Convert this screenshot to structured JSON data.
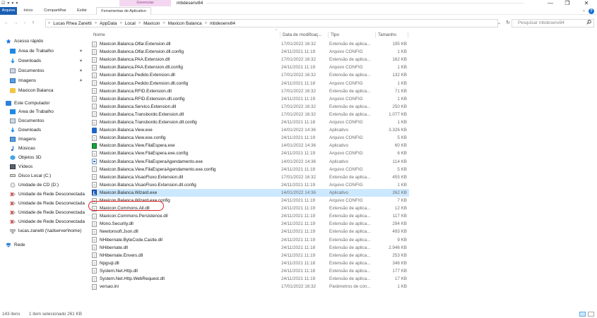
{
  "window": {
    "title": "mbdesenv84",
    "context_tab_group": "Gerenciar",
    "controls": {
      "minimize": "—",
      "maximize": "❐",
      "close": "✕"
    }
  },
  "quick_access_toolbar": {
    "items": [
      "☑",
      "▾",
      "▾",
      "▾"
    ]
  },
  "ribbon": {
    "tabs": [
      "Arquivo",
      "Início",
      "Compartilhar",
      "Exibir",
      "Ferramentas de Aplicativo"
    ],
    "help": "?",
    "collapse": "⌄"
  },
  "address_bar": {
    "nav": {
      "back": "←",
      "forward": "→",
      "recent": "⌄",
      "up": "↑"
    },
    "crumbs": [
      "Lucas Rhea Zanetti",
      "AppData",
      "Local",
      "Maxicon",
      "Maxicon Balanca",
      "mbdesenv84"
    ],
    "separator": ">",
    "dropdown": "⌄",
    "refresh": "↻",
    "search_placeholder": "Pesquisar mbdesenv84"
  },
  "nav_pane": {
    "quick_access_label": "Acesso rápido",
    "quick_access_items": [
      {
        "label": "Área de Trabalho",
        "icon": "desktop-icon",
        "pinned": true
      },
      {
        "label": "Downloads",
        "icon": "downloads-icon",
        "pinned": true
      },
      {
        "label": "Documentos",
        "icon": "documents-icon",
        "pinned": true
      },
      {
        "label": "Imagens",
        "icon": "pictures-icon",
        "pinned": true
      },
      {
        "label": "Maxicon Balanca",
        "icon": "folder-icon",
        "pinned": false
      }
    ],
    "this_pc_label": "Este Computador",
    "this_pc_items": [
      {
        "label": "Área de Trabalho",
        "icon": "desktop-icon"
      },
      {
        "label": "Documentos",
        "icon": "documents-icon"
      },
      {
        "label": "Downloads",
        "icon": "downloads-icon"
      },
      {
        "label": "Imagens",
        "icon": "pictures-icon"
      },
      {
        "label": "Músicas",
        "icon": "music-icon"
      },
      {
        "label": "Objetos 3D",
        "icon": "objects3d-icon"
      },
      {
        "label": "Vídeos",
        "icon": "videos-icon"
      },
      {
        "label": "Disco Local (C:)",
        "icon": "drive-icon"
      },
      {
        "label": "Unidade de CD (D:)",
        "icon": "cd-drive-icon"
      },
      {
        "label": "Unidade de Rede Desconectada",
        "icon": "network-drive-disconnected-icon"
      },
      {
        "label": "Unidade de Rede Desconectada",
        "icon": "network-drive-disconnected-icon"
      },
      {
        "label": "Unidade de Rede Desconectada",
        "icon": "network-drive-disconnected-icon"
      },
      {
        "label": "Unidade de Rede Desconectada",
        "icon": "network-drive-disconnected-icon"
      },
      {
        "label": "lucas.zanetti (\\\\adserver\\home)",
        "icon": "network-drive-icon"
      }
    ],
    "network_label": "Rede",
    "pin_glyph": "✶"
  },
  "file_list": {
    "columns": {
      "name": "Nome",
      "date": "Data de modificaç...",
      "type": "Tipo",
      "size": "Tamanho"
    },
    "sort_glyph": "^",
    "selected_index": 21,
    "rows": [
      {
        "name": "Maxicon.Balanca.Olfar.Extension.dll",
        "date": "17/01/2022 16:32",
        "type": "Extensão de aplica...",
        "size": "195 KB",
        "icon": "doc"
      },
      {
        "name": "Maxicon.Balanca.Olfar.Extension.dll.config",
        "date": "24/11/2021 11:19",
        "type": "Arquivo CONFIG",
        "size": "1 KB",
        "icon": "doc"
      },
      {
        "name": "Maxicon.Balanca.PAA.Extension.dll",
        "date": "17/01/2022 16:32",
        "type": "Extensão de aplica...",
        "size": "162 KB",
        "icon": "doc"
      },
      {
        "name": "Maxicon.Balanca.PAA.Extension.dll.config",
        "date": "24/11/2021 11:19",
        "type": "Arquivo CONFIG",
        "size": "1 KB",
        "icon": "doc"
      },
      {
        "name": "Maxicon.Balanca.Pedido.Extension.dll",
        "date": "17/01/2022 16:32",
        "type": "Extensão de aplica...",
        "size": "132 KB",
        "icon": "doc"
      },
      {
        "name": "Maxicon.Balanca.Pedido.Extension.dll.config",
        "date": "24/11/2021 11:18",
        "type": "Arquivo CONFIG",
        "size": "1 KB",
        "icon": "doc"
      },
      {
        "name": "Maxicon.Balanca.RFID.Extension.dll",
        "date": "17/01/2022 16:32",
        "type": "Extensão de aplica...",
        "size": "71 KB",
        "icon": "doc"
      },
      {
        "name": "Maxicon.Balanca.RFID.Extension.dll.config",
        "date": "24/11/2021 11:19",
        "type": "Arquivo CONFIG",
        "size": "1 KB",
        "icon": "doc"
      },
      {
        "name": "Maxicon.Balanca.Servico.Extension.dll",
        "date": "17/01/2022 16:32",
        "type": "Extensão de aplica...",
        "size": "250 KB",
        "icon": "doc"
      },
      {
        "name": "Maxicon.Balanca.Transbordo.Extension.dll",
        "date": "17/01/2022 16:32",
        "type": "Extensão de aplica...",
        "size": "1.077 KB",
        "icon": "doc"
      },
      {
        "name": "Maxicon.Balanca.Transbordo.Extension.dll.config",
        "date": "24/11/2021 11:18",
        "type": "Arquivo CONFIG",
        "size": "1 KB",
        "icon": "doc"
      },
      {
        "name": "Maxicon.Balanca.View.exe",
        "date": "14/01/2022 14:36",
        "type": "Aplicativo",
        "size": "3.326 KB",
        "icon": "exe-blue"
      },
      {
        "name": "Maxicon.Balanca.View.exe.config",
        "date": "24/11/2021 11:19",
        "type": "Arquivo CONFIG",
        "size": "5 KB",
        "icon": "doc"
      },
      {
        "name": "Maxicon.Balanca.View.FilaEspera.exe",
        "date": "14/01/2022 14:36",
        "type": "Aplicativo",
        "size": "60 KB",
        "icon": "exe-green"
      },
      {
        "name": "Maxicon.Balanca.View.FilaEspera.exe.config",
        "date": "24/11/2021 11:19",
        "type": "Arquivo CONFIG",
        "size": "6 KB",
        "icon": "doc"
      },
      {
        "name": "Maxicon.Balanca.View.FilaEsperaAgendamento.exe",
        "date": "14/01/2022 14:36",
        "type": "Aplicativo",
        "size": "114 KB",
        "icon": "exe-app"
      },
      {
        "name": "Maxicon.Balanca.View.FilaEsperaAgendamento.exe.config",
        "date": "24/11/2021 11:18",
        "type": "Arquivo CONFIG",
        "size": "5 KB",
        "icon": "doc"
      },
      {
        "name": "Maxicon.Balanca.VisaoFluxo.Extension.dll",
        "date": "17/01/2022 16:32",
        "type": "Extensão de aplica...",
        "size": "455 KB",
        "icon": "doc"
      },
      {
        "name": "Maxicon.Balanca.VisaoFluxo.Extension.dll.config",
        "date": "24/11/2021 11:19",
        "type": "Arquivo CONFIG",
        "size": "1 KB",
        "icon": "doc"
      },
      {
        "name": "Maxicon.Balanca.Wizard.exe",
        "date": "14/01/2022 14:36",
        "type": "Aplicativo",
        "size": "262 KB",
        "icon": "wizard"
      },
      {
        "name": "Maxicon.Balanca.Wizard.exe.config",
        "date": "24/11/2021 11:19",
        "type": "Arquivo CONFIG",
        "size": "7 KB",
        "icon": "doc"
      },
      {
        "name": "Maxicon.Commons.All.dll",
        "date": "24/11/2021 11:19",
        "type": "Extensão de aplica...",
        "size": "12 KB",
        "icon": "doc"
      },
      {
        "name": "Maxicon.Commons.Persistence.dll",
        "date": "24/11/2021 11:19",
        "type": "Extensão de aplica...",
        "size": "117 KB",
        "icon": "doc"
      },
      {
        "name": "Mono.Security.dll",
        "date": "24/11/2021 11:19",
        "type": "Extensão de aplica...",
        "size": "294 KB",
        "icon": "doc"
      },
      {
        "name": "Newtonsoft.Json.dll",
        "date": "24/11/2021 11:19",
        "type": "Extensão de aplica...",
        "size": "493 KB",
        "icon": "doc"
      },
      {
        "name": "NHibernate.ByteCode.Castle.dll",
        "date": "24/11/2021 11:19",
        "type": "Extensão de aplica...",
        "size": "9 KB",
        "icon": "doc"
      },
      {
        "name": "NHibernate.dll",
        "date": "24/11/2021 11:18",
        "type": "Extensão de aplica...",
        "size": "2.946 KB",
        "icon": "doc"
      },
      {
        "name": "NHibernate.Envers.dll",
        "date": "24/11/2021 11:19",
        "type": "Extensão de aplica...",
        "size": "253 KB",
        "icon": "doc"
      },
      {
        "name": "Npgsql.dll",
        "date": "24/11/2021 11:18",
        "type": "Extensão de aplica...",
        "size": "346 KB",
        "icon": "doc"
      },
      {
        "name": "System.Net.Http.dll",
        "date": "24/11/2021 11:18",
        "type": "Extensão de aplica...",
        "size": "177 KB",
        "icon": "doc"
      },
      {
        "name": "System.Net.Http.WebRequest.dll",
        "date": "24/11/2021 11:19",
        "type": "Extensão de aplica...",
        "size": "17 KB",
        "icon": "doc"
      },
      {
        "name": "versao.ini",
        "date": "17/01/2022 16:32",
        "type": "Parâmetros de con...",
        "size": "1 KB",
        "icon": "doc"
      }
    ]
  },
  "status_bar": {
    "item_count": "143 itens",
    "selection": "1 item selecionado  261 KB"
  },
  "colors": {
    "accent": "#1a5fb4",
    "selection": "#cce8ff",
    "context_tab": "#f3d7f0",
    "annotation_ring": "#e0242c"
  }
}
